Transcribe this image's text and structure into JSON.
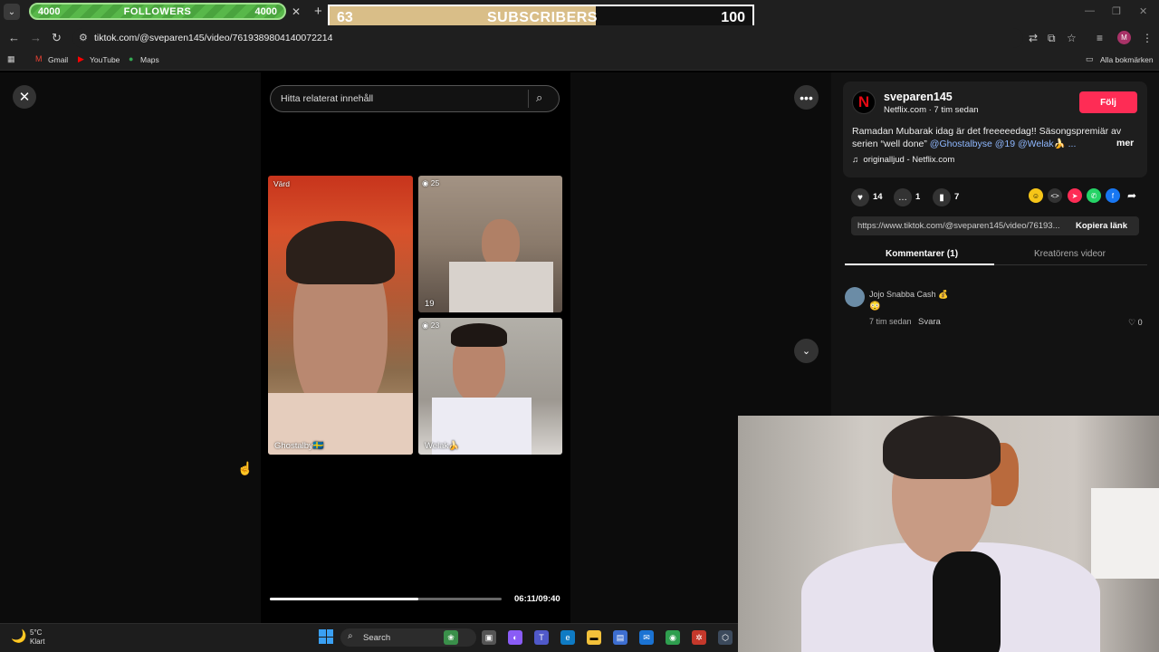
{
  "browser": {
    "url": "tiktok.com/@sveparen145/video/7619389804140072214",
    "bookmarks": [
      "Gmail",
      "YouTube",
      "Maps"
    ],
    "all_bookmarks": "Alla bokmärken",
    "profile_initial": "M"
  },
  "overlay": {
    "followers_left": "4000",
    "followers_label": "FOLLOWERS",
    "followers_right": "4000",
    "subscribers_current": "63",
    "subscribers_label": "SUBSCRIBERS",
    "subscribers_goal": "100",
    "subscribers_progress": 0.63
  },
  "player": {
    "search_placeholder": "Hitta relaterat innehåll",
    "host_badge": "Värd",
    "host_name": "Ghostalby🇸🇪",
    "guest1_badge": "25",
    "guest1_count": "19",
    "guest2_badge": "23",
    "guest2_name": "Welak🍌",
    "timecode": "06:11/09:40",
    "progress": 0.64
  },
  "post": {
    "username": "sveparen145",
    "subline": "Netflix.com · 7 tim sedan",
    "follow_label": "Följ",
    "desc_text": "Ramadan Mubarak idag är det freeeeedag!! Säsongspremiär av serien “well done” ",
    "desc_tags": "@Ghostalbyse @19 @Welak🍌 ...",
    "more_label": "mer",
    "music": "originalljud - Netflix.com",
    "likes": "14",
    "comments": "1",
    "saves": "7",
    "link": "https://www.tiktok.com/@sveparen145/video/76193...",
    "copy_label": "Kopiera länk",
    "tab_comments": "Kommentarer (1)",
    "tab_creator": "Kreatörens videor"
  },
  "comment": {
    "author": "Jojo Snabba Cash 💰",
    "text": "😳",
    "time": "7 tim sedan",
    "reply": "Svara",
    "likes": "0"
  },
  "taskbar": {
    "temp": "5°C",
    "condition": "Klart",
    "search": "Search"
  },
  "colors": {
    "follow": "#fe2c55",
    "followers_bar": "#58b84a",
    "subs_fill": "#d9be88"
  }
}
